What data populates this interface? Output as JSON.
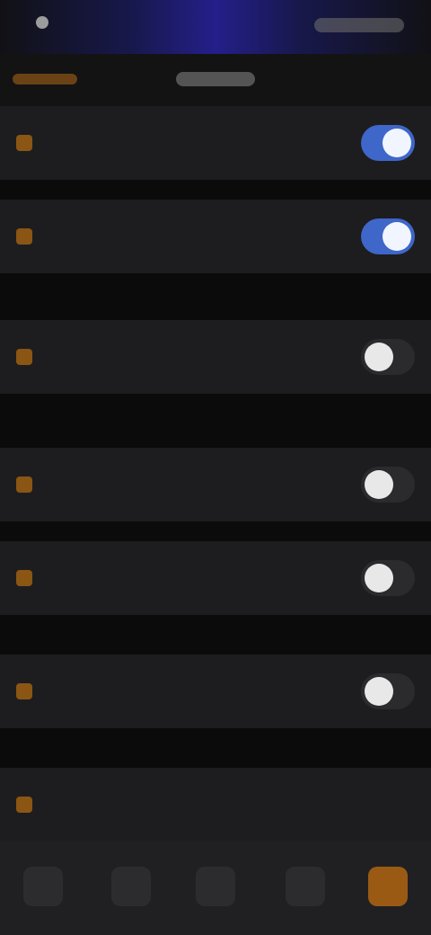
{
  "top_tabs": {
    "left": "",
    "center": ""
  },
  "settings": [
    {
      "label": "",
      "toggle": true
    },
    {
      "label": "",
      "toggle": true
    },
    {
      "label": "",
      "toggle": false
    },
    {
      "label": "",
      "toggle": false
    },
    {
      "label": "",
      "toggle": false
    },
    {
      "label": "",
      "toggle": false
    },
    {
      "label": ""
    }
  ],
  "bottom_nav": [
    "",
    "",
    "",
    "",
    ""
  ],
  "accent": {
    "primary": "#b06810",
    "toggle_on": "#3f66c9",
    "header_gradient": "#241f8a"
  }
}
